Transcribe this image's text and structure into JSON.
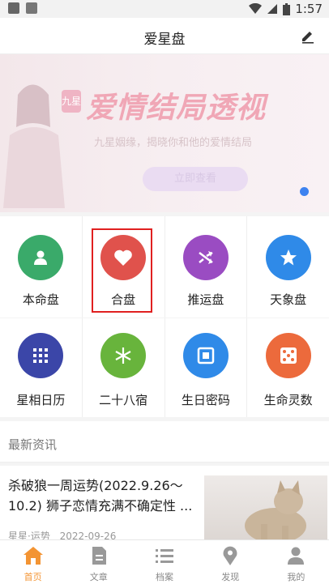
{
  "status_bar": {
    "time": "1:57"
  },
  "app_bar": {
    "title": "爱星盘"
  },
  "banner": {
    "badge": "九星",
    "headline": "爱情结局透视",
    "subtitle": "九星姻缘，揭晓你和他的爱情结局",
    "cta": "立即查看"
  },
  "features_row1": [
    {
      "label": "本命盘",
      "icon": "person-icon",
      "color": "#3aaa6a"
    },
    {
      "label": "合盘",
      "icon": "heart-icon",
      "color": "#e0524c"
    },
    {
      "label": "推运盘",
      "icon": "shuffle-icon",
      "color": "#9a4cc2"
    },
    {
      "label": "天象盘",
      "icon": "star-icon",
      "color": "#2f8ae8"
    }
  ],
  "features_row2": [
    {
      "label": "星相日历",
      "icon": "grid-icon",
      "color": "#3b46a8"
    },
    {
      "label": "二十八宿",
      "icon": "snowflake-icon",
      "color": "#68b43c"
    },
    {
      "label": "生日密码",
      "icon": "frame-icon",
      "color": "#2f8ae8"
    },
    {
      "label": "生命灵数",
      "icon": "dice-icon",
      "color": "#ec6a3c"
    }
  ],
  "news_section": {
    "header": "最新资讯",
    "item": {
      "title": "杀破狼一周运势(2022.9.26～10.2) 狮子恋情充满不确定性 ...",
      "source": "星星·运势",
      "date": "2022-09-26"
    }
  },
  "tabs": [
    {
      "label": "首页",
      "icon": "home-icon",
      "active": true
    },
    {
      "label": "文章",
      "icon": "document-icon",
      "active": false
    },
    {
      "label": "档案",
      "icon": "list-icon",
      "active": false
    },
    {
      "label": "发现",
      "icon": "location-pin-icon",
      "active": false
    },
    {
      "label": "我的",
      "icon": "user-icon",
      "active": false
    }
  ],
  "accent_color": "#f39433"
}
